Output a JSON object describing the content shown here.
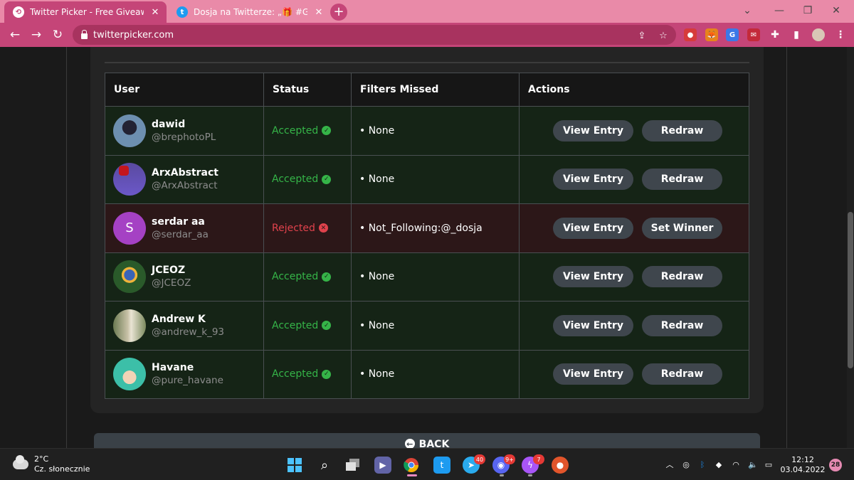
{
  "browser": {
    "tabs": [
      {
        "title": "Twitter Picker - Free Giveaway Pic",
        "active": true,
        "favicon": "twitter-picker-favicon"
      },
      {
        "title": "Dosja na Twitterze: „🎁 #Giveaw",
        "active": false,
        "favicon": "twitter-bird-icon"
      }
    ],
    "new_tab_label": "+",
    "url": "twitterpicker.com"
  },
  "table": {
    "headers": {
      "user": "User",
      "status": "Status",
      "filters": "Filters Missed",
      "actions": "Actions"
    },
    "rows": [
      {
        "name": "dawid",
        "handle": "@brephotoPL",
        "status": "Accepted",
        "filter": "• None",
        "view": "View Entry",
        "secondary": "Redraw"
      },
      {
        "name": "ArxAbstract",
        "handle": "@ArxAbstract",
        "status": "Accepted",
        "filter": "• None",
        "view": "View Entry",
        "secondary": "Redraw"
      },
      {
        "name": "serdar aa",
        "handle": "@serdar_aa",
        "status": "Rejected",
        "filter": "• Not_Following:@_dosja",
        "view": "View Entry",
        "secondary": "Set Winner",
        "avatar_letter": "S"
      },
      {
        "name": "JCEOZ",
        "handle": "@JCEOZ",
        "status": "Accepted",
        "filter": "• None",
        "view": "View Entry",
        "secondary": "Redraw"
      },
      {
        "name": "Andrew K",
        "handle": "@andrew_k_93",
        "status": "Accepted",
        "filter": "• None",
        "view": "View Entry",
        "secondary": "Redraw"
      },
      {
        "name": "Havane",
        "handle": "@pure_havane",
        "status": "Accepted",
        "filter": "• None",
        "view": "View Entry",
        "secondary": "Redraw"
      }
    ]
  },
  "back_label": "BACK",
  "colors": {
    "accepted": "#35b448",
    "rejected": "#e0424c",
    "tab_active": "#c54578",
    "tab_strip": "#e98aa8"
  },
  "taskbar": {
    "weather_temp": "2°C",
    "weather_desc": "Cz. słonecznie",
    "time": "12:12",
    "date": "03.04.2022",
    "notification_count": "28",
    "telegram_badge": "40",
    "discord_badge": "9+",
    "messenger_badge": "7"
  }
}
